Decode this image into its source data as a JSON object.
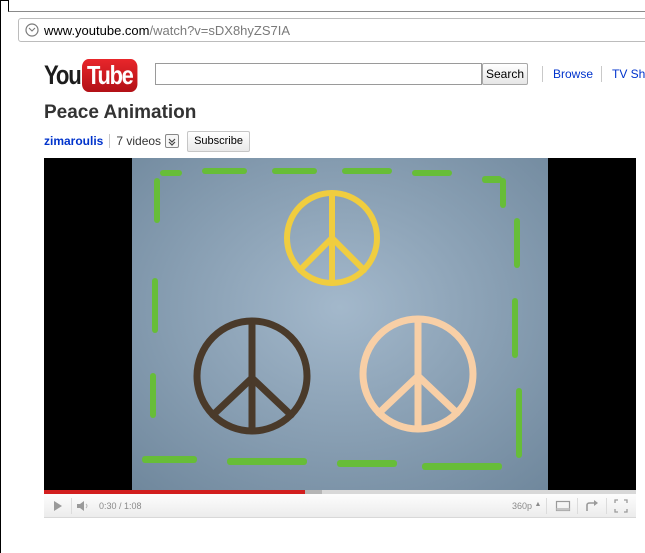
{
  "browser": {
    "url_host": "www.youtube.com",
    "url_path": "/watch?v=sDX8hyZS7IA"
  },
  "header": {
    "logo_you": "You",
    "logo_tube": "Tube",
    "search_value": "",
    "search_button": "Search",
    "nav": [
      "Browse",
      "TV Sh"
    ]
  },
  "video": {
    "title": "Peace Animation",
    "channel": "zimaroulis",
    "video_count": "7 videos",
    "subscribe_label": "Subscribe"
  },
  "player": {
    "time": "0:30 / 1:08",
    "quality": "360p",
    "played_fraction": 0.441,
    "loaded_fraction": 0.47
  },
  "colors": {
    "accent_red": "#d21f1f",
    "link_blue": "#0033cc",
    "peace_yellow": "#f2d24a",
    "peace_brown": "#4a3b2c",
    "peace_peach": "#f7d0a8",
    "border_green": "#6cc23c",
    "backdrop": "#8fa7bd"
  },
  "icons": {
    "address": "globe-icon",
    "play": "play-icon",
    "volume": "volume-icon",
    "quality": "quality-caret-icon",
    "popout": "popout-icon",
    "share": "share-icon",
    "fullscreen": "fullscreen-icon",
    "dropdown": "chevron-down-icon"
  }
}
